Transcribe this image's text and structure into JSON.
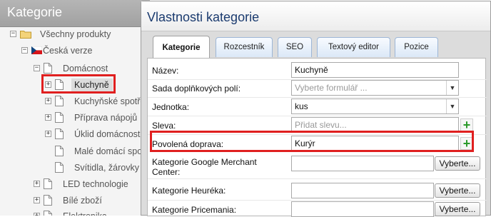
{
  "tree_panel": {
    "title": "Kategorie",
    "items": [
      {
        "label": "Všechny produkty"
      },
      {
        "label": "Česká verze"
      },
      {
        "label": "Domácnost"
      },
      {
        "label": "Kuchyně"
      },
      {
        "label": "Kuchyňské spotřebiče"
      },
      {
        "label": "Příprava nápojů"
      },
      {
        "label": "Úklid domácnosti"
      },
      {
        "label": "Malé domácí spotřebiče"
      },
      {
        "label": "Svítidla, žárovky"
      },
      {
        "label": "LED technologie"
      },
      {
        "label": "Bílé zboží"
      },
      {
        "label": "Elektronika"
      }
    ]
  },
  "dialog": {
    "title": "Vlastnosti kategorie",
    "tabs": [
      {
        "label": "Kategorie",
        "active": true
      },
      {
        "label": "Rozcestník"
      },
      {
        "label": "SEO"
      },
      {
        "label": "Textový editor"
      },
      {
        "label": "Pozice"
      }
    ],
    "fields": {
      "name": {
        "label": "Název:",
        "value": "Kuchyně"
      },
      "addon_fields": {
        "label": "Sada doplňkových polí:",
        "placeholder": "Vyberte formulář ..."
      },
      "unit": {
        "label": "Jednotka:",
        "value": "kus"
      },
      "discount": {
        "label": "Sleva:",
        "placeholder": "Přidat slevu..."
      },
      "shipping": {
        "label": "Povolená doprava:",
        "value": "Kurýr"
      },
      "google": {
        "label1": "Kategorie Google Merchant",
        "label2": "Center:",
        "button": "Vyberte..."
      },
      "heureka": {
        "label": "Kategorie Heuréka:",
        "button": "Vyberte..."
      },
      "pricemania": {
        "label": "Kategorie Pricemania:",
        "button": "Vyberte..."
      }
    }
  },
  "colors": {
    "highlight": "#e01f1f",
    "title_blue": "#1b3b6f",
    "plus_green": "#2a9a2a"
  }
}
